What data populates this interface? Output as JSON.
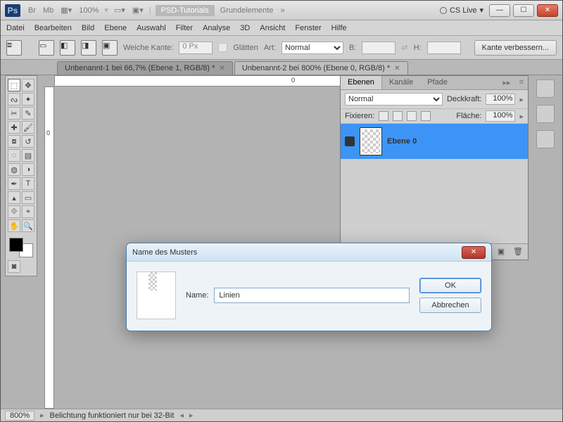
{
  "titlebar": {
    "app_short": "Ps",
    "chips": [
      "Br",
      "Mb"
    ],
    "zoom": "100%",
    "psd_tutorials": "PSD-Tutorials",
    "grundelemente": "Grundelemente",
    "chevrons": "»",
    "cs_live": "CS Live"
  },
  "menu": [
    "Datei",
    "Bearbeiten",
    "Bild",
    "Ebene",
    "Auswahl",
    "Filter",
    "Analyse",
    "3D",
    "Ansicht",
    "Fenster",
    "Hilfe"
  ],
  "options": {
    "weiche_kante_label": "Weiche Kante:",
    "weiche_kante_value": "0 Px",
    "glaetten_label": "Glätten",
    "art_label": "Art:",
    "art_value": "Normal",
    "b_label": "B:",
    "h_label": "H:",
    "kante_btn": "Kante verbessern..."
  },
  "doc_tabs": [
    {
      "label": "Unbenannt-1 bei 66,7% (Ebene 1, RGB/8) *",
      "active": false
    },
    {
      "label": "Unbenannt-2 bei 800% (Ebene 0, RGB/8) *",
      "active": true
    }
  ],
  "ruler_zero": "0",
  "layers_panel": {
    "tabs": [
      "Ebenen",
      "Kanäle",
      "Pfade"
    ],
    "blend_mode": "Normal",
    "opacity_label": "Deckkraft:",
    "opacity_value": "100%",
    "lock_label": "Fixieren:",
    "fill_label": "Fläche:",
    "fill_value": "100%",
    "layer_name": "Ebene 0"
  },
  "dialog": {
    "title": "Name des Musters",
    "name_label": "Name:",
    "name_value": "Linien",
    "ok": "OK",
    "cancel": "Abbrechen"
  },
  "status": {
    "zoom": "800%",
    "msg": "Belichtung funktioniert nur bei 32-Bit"
  }
}
